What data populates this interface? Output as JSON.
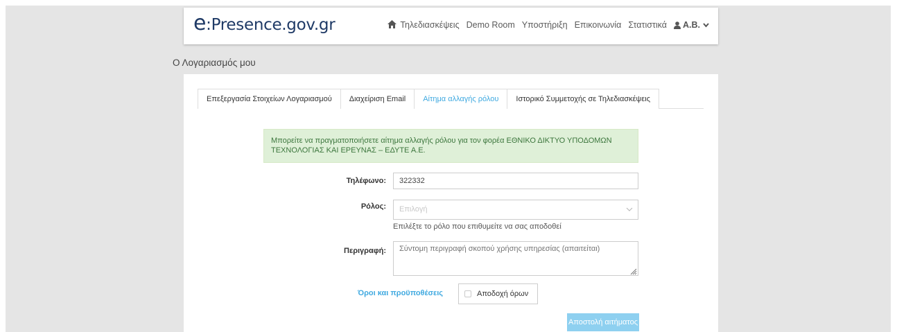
{
  "header": {
    "logo_prefix": "e",
    "logo_rest": ":Presence.gov.gr",
    "nav": {
      "teleconferences": "Τηλεδιασκέψεις",
      "demo_room": "Demo Room",
      "support": "Υποστήριξη",
      "contact": "Επικοινωνία",
      "statistics": "Στατιστικά",
      "user": "A.B."
    }
  },
  "page_title": "Ο Λογαριασμός μου",
  "tabs": {
    "account_edit": "Επεξεργασία Στοιχείων Λογαριασμού",
    "email_manage": "Διαχείριση Email",
    "role_change": "Αίτημα αλλαγής ρόλου",
    "history": "Ιστορικό Συμμετοχής σε Τηλεδιασκέψεις"
  },
  "alert": {
    "text": "Μπορείτε να πραγματοποιήσετε αίτημα αλλαγής ρόλου για τον φορέα ΕΘΝΙΚΟ ΔΙΚΤΥΟ ΥΠΟΔΟΜΩΝ ΤΕΧΝΟΛΟΓΙΑΣ ΚΑΙ ΕΡΕΥΝΑΣ – ΕΔΥΤΕ Α.Ε."
  },
  "form": {
    "phone_label": "Τηλέφωνο:",
    "phone_value": "322332",
    "role_label": "Ρόλος:",
    "role_placeholder": "Επιλογή",
    "role_help": "Επιλέξτε το ρόλο που επιθυμείτε να σας αποδοθεί",
    "description_label": "Περιγραφή:",
    "description_placeholder": "Σύντομη περιγραφή σκοπού χρήσης υπηρεσίας (απαιτείται)",
    "terms_link": "Όροι και προϋποθέσεις",
    "accept_terms": "Αποδοχή όρων",
    "submit": "Αποστολή αιτήματος"
  }
}
